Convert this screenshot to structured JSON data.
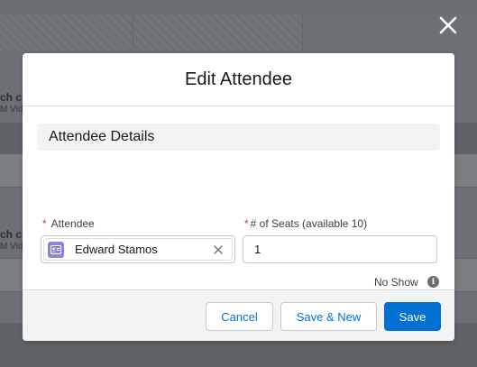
{
  "background": {
    "row_text_1": "ch ch",
    "row_subtext_1": "M Vid",
    "row_text_2": "ch ch",
    "row_subtext_2": "M Vid"
  },
  "modal": {
    "title": "Edit Attendee",
    "section_title": "Attendee Details",
    "fields": {
      "attendee": {
        "required_marker": "*",
        "label": "Attendee",
        "value": "Edward Stamos",
        "icon": "contact-card-icon"
      },
      "seats": {
        "required_marker": "*",
        "label": "# of Seats (available 10)",
        "value": "1"
      },
      "no_show": {
        "label": "No Show",
        "info_glyph": "i",
        "checked": false
      }
    },
    "footer": {
      "cancel_label": "Cancel",
      "save_new_label": "Save & New",
      "save_label": "Save"
    }
  },
  "colors": {
    "brand": "#0070d2",
    "required": "#c23934",
    "pill_icon": "#8b85d6"
  }
}
